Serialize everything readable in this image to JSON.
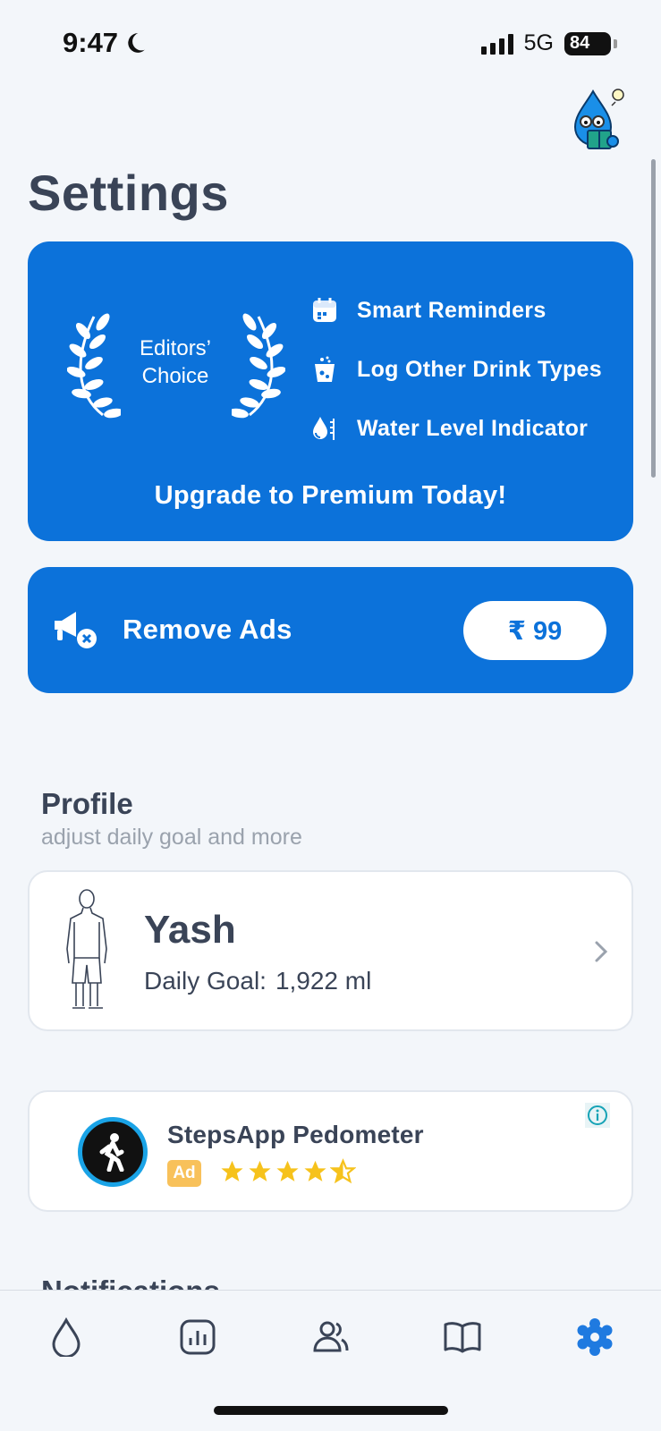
{
  "status_bar": {
    "time": "9:47",
    "network": "5G",
    "battery": "84"
  },
  "page": {
    "title": "Settings"
  },
  "premium": {
    "badge_line1": "Editors’",
    "badge_line2": "Choice",
    "features": [
      {
        "label": "Smart Reminders",
        "icon": "calendar-icon"
      },
      {
        "label": "Log Other Drink Types",
        "icon": "drink-cup-icon"
      },
      {
        "label": "Water Level Indicator",
        "icon": "water-level-icon"
      }
    ],
    "cta": "Upgrade to Premium Today!"
  },
  "remove_ads": {
    "label": "Remove Ads",
    "price": "₹ 99",
    "icon": "megaphone-off-icon"
  },
  "profile_section": {
    "title": "Profile",
    "subtitle": "adjust daily goal and more",
    "name": "Yash",
    "goal_label": "Daily Goal:",
    "goal_value": "1,922 ml"
  },
  "ad": {
    "title": "StepsApp Pedometer",
    "badge": "Ad",
    "rating": 4.5,
    "icon": "walking-person-icon"
  },
  "next_section": {
    "title": "Notifications"
  },
  "tabs": [
    {
      "name": "water-drop-icon",
      "active": false
    },
    {
      "name": "statistics-icon",
      "active": false
    },
    {
      "name": "friends-icon",
      "active": false
    },
    {
      "name": "book-icon",
      "active": false
    },
    {
      "name": "settings-gear-icon",
      "active": true
    }
  ],
  "colors": {
    "primary": "#0c72da",
    "background": "#f3f6fa",
    "text": "#3a4457",
    "muted": "#9aa2ad",
    "star": "#f6c21c"
  }
}
